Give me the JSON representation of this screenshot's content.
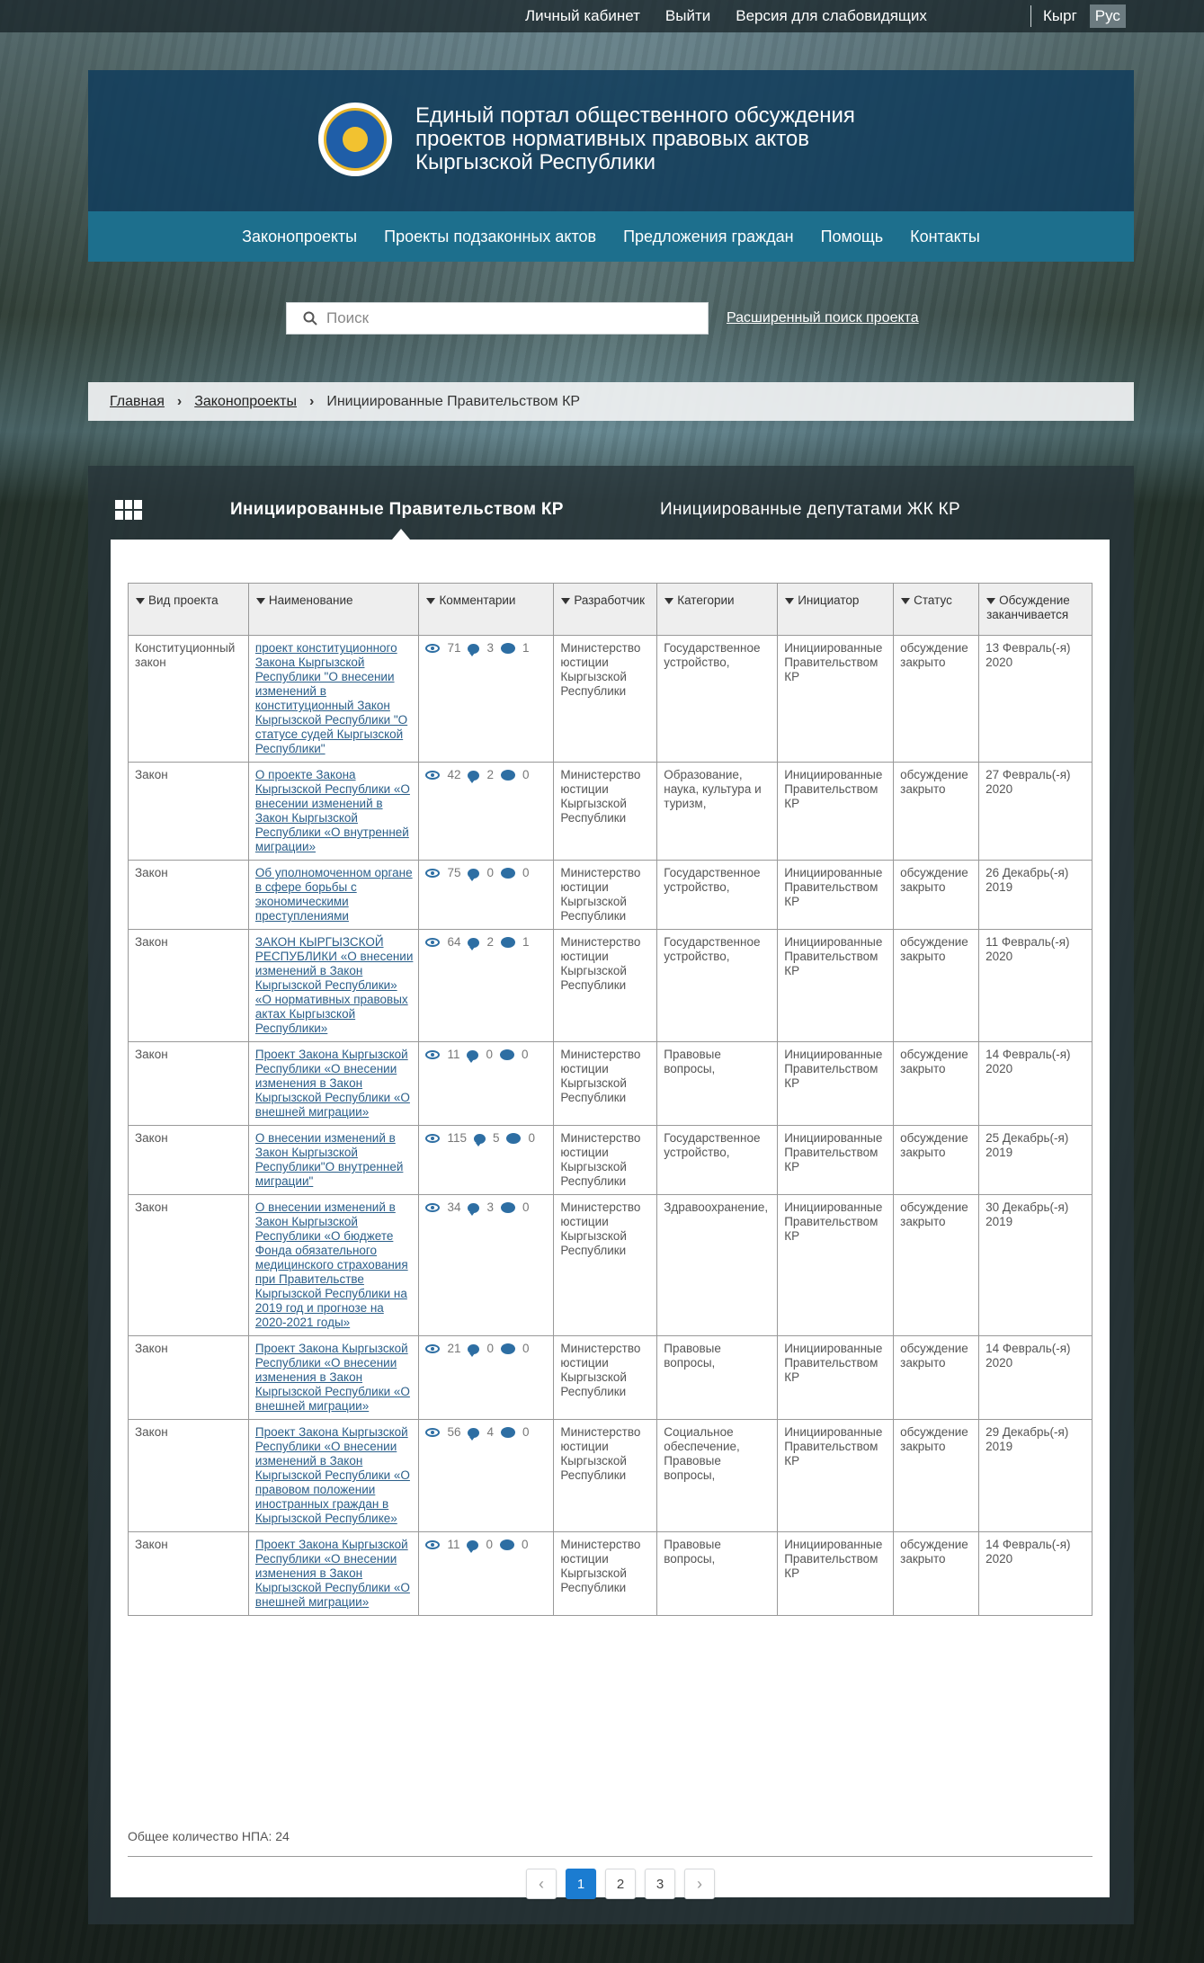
{
  "topbar": {
    "links": [
      "Личный кабинет",
      "Выйти",
      "Версия для слабовидящих"
    ],
    "lang": [
      "Кырг",
      "Рус"
    ],
    "active_lang": "Рус"
  },
  "header": {
    "title_lines": [
      "Единый портал общественного обсуждения",
      "проектов нормативных правовых актов",
      "Кыргызской Республики"
    ]
  },
  "nav": [
    "Законопроекты",
    "Проекты подзаконных актов",
    "Предложения граждан",
    "Помощь",
    "Контакты"
  ],
  "search": {
    "placeholder": "Поиск",
    "advanced_label": "Расширенный поиск проекта"
  },
  "breadcrumb": {
    "home": "Главная",
    "section": "Законопроекты",
    "current": "Инициированные Правительством КР"
  },
  "tabs": {
    "active": "Инициированные Правительством КР",
    "other": "Инициированные депутатами ЖК КР"
  },
  "table": {
    "headers": [
      "Вид проекта",
      "Наименование",
      "Комментарии",
      "Разработчик",
      "Категории",
      "Инициатор",
      "Статус",
      "Обсуждение заканчивается"
    ],
    "rows": [
      {
        "type": "Конституционный закон",
        "name": "проект конституционного Закона Кыргызской Республики \"О внесении изменений в конституционный Закон Кыргызской Республики \"О статусе судей Кыргызской Республики\"",
        "views": "71",
        "comments": "3",
        "replies": "1",
        "developer": "Министерство юстиции Кыргызской Республики",
        "category": "Государственное устройство,",
        "initiator": "Инициированные Правительством КР",
        "status": "обсуждение закрыто",
        "ends": "13 Февраль(-я) 2020"
      },
      {
        "type": "Закон",
        "name": "О проекте Закона Кыргызской Республики «О внесении изменений в Закон Кыргызской Республики «О внутренней миграции»",
        "views": "42",
        "comments": "2",
        "replies": "0",
        "developer": "Министерство юстиции Кыргызской Республики",
        "category": "Образование, наука, культура и туризм,",
        "initiator": "Инициированные Правительством КР",
        "status": "обсуждение закрыто",
        "ends": "27 Февраль(-я) 2020"
      },
      {
        "type": "Закон",
        "name": "Об уполномоченном органе в сфере борьбы с экономическими преступлениями",
        "views": "75",
        "comments": "0",
        "replies": "0",
        "developer": "Министерство юстиции Кыргызской Республики",
        "category": "Государственное устройство,",
        "initiator": "Инициированные Правительством КР",
        "status": "обсуждение закрыто",
        "ends": "26 Декабрь(-я) 2019"
      },
      {
        "type": "Закон",
        "name": "ЗАКОН КЫРГЫЗСКОЙ РЕСПУБЛИКИ «О внесении изменений в Закон Кыргызской Республики» «О нормативных правовых актах Кыргызской Республики»",
        "views": "64",
        "comments": "2",
        "replies": "1",
        "developer": "Министерство юстиции Кыргызской Республики",
        "category": "Государственное устройство,",
        "initiator": "Инициированные Правительством КР",
        "status": "обсуждение закрыто",
        "ends": "11 Февраль(-я) 2020"
      },
      {
        "type": "Закон",
        "name": "Проект Закона Кыргызской Республики «О внесении изменения в Закон Кыргызской Республики «О внешней миграции»",
        "views": "11",
        "comments": "0",
        "replies": "0",
        "developer": "Министерство юстиции Кыргызской Республики",
        "category": "Правовые вопросы,",
        "initiator": "Инициированные Правительством КР",
        "status": "обсуждение закрыто",
        "ends": "14 Февраль(-я) 2020"
      },
      {
        "type": "Закон",
        "name": "О внесении изменений в Закон Кыргызской Республики\"О внутренней миграции\"",
        "views": "115",
        "comments": "5",
        "replies": "0",
        "developer": "Министерство юстиции Кыргызской Республики",
        "category": "Государственное устройство,",
        "initiator": "Инициированные Правительством КР",
        "status": "обсуждение закрыто",
        "ends": "25 Декабрь(-я) 2019"
      },
      {
        "type": "Закон",
        "name": "О внесении изменений в Закон Кыргызской Республики «О бюджете Фонда обязательного медицинского страхования при Правительстве Кыргызской Республики на 2019 год и прогнозе на 2020-2021 годы»",
        "views": "34",
        "comments": "3",
        "replies": "0",
        "developer": "Министерство юстиции Кыргызской Республики",
        "category": "Здравоохранение,",
        "initiator": "Инициированные Правительством КР",
        "status": "обсуждение закрыто",
        "ends": "30 Декабрь(-я) 2019"
      },
      {
        "type": "Закон",
        "name": "Проект Закона Кыргызской Республики «О внесении изменения в Закон Кыргызской Республики «О внешней миграции»",
        "views": "21",
        "comments": "0",
        "replies": "0",
        "developer": "Министерство юстиции Кыргызской Республики",
        "category": "Правовые вопросы,",
        "initiator": "Инициированные Правительством КР",
        "status": "обсуждение закрыто",
        "ends": "14 Февраль(-я) 2020"
      },
      {
        "type": "Закон",
        "name": "Проект Закона Кыргызской Республики «О внесении изменений в Закон Кыргызской Республики «О правовом положении иностранных граждан в Кыргызской Республике»",
        "views": "56",
        "comments": "4",
        "replies": "0",
        "developer": "Министерство юстиции Кыргызской Республики",
        "category": "Социальное обеспечение, Правовые вопросы,",
        "initiator": "Инициированные Правительством КР",
        "status": "обсуждение закрыто",
        "ends": "29 Декабрь(-я) 2019"
      },
      {
        "type": "Закон",
        "name": "Проект Закона Кыргызской Республики «О внесении изменения в Закон Кыргызской Республики «О внешней миграции»",
        "views": "11",
        "comments": "0",
        "replies": "0",
        "developer": "Министерство юстиции Кыргызской Республики",
        "category": "Правовые вопросы,",
        "initiator": "Инициированные Правительством КР",
        "status": "обсуждение закрыто",
        "ends": "14 Февраль(-я) 2020"
      }
    ]
  },
  "total_label": "Общее количество НПА: 24",
  "pagination": {
    "prev": "‹",
    "pages": [
      "1",
      "2",
      "3"
    ],
    "active": "1",
    "next": "›"
  },
  "colors": {
    "header_bg": "#123e5c",
    "nav_bg": "#1d6f8d",
    "link": "#2b5f8a",
    "icon": "#2d6ea3",
    "page_active": "#1b7cd1"
  }
}
